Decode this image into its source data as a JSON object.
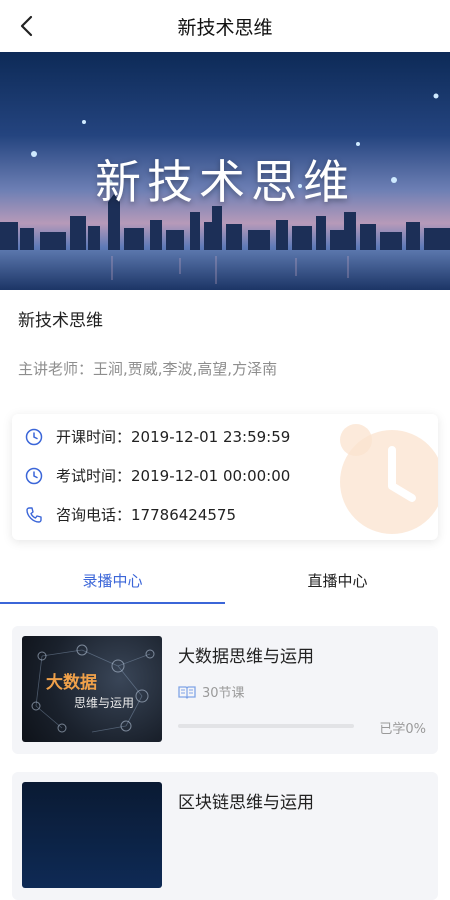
{
  "header": {
    "title": "新技术思维",
    "back_icon": "chevron-left-icon"
  },
  "banner": {
    "title": "新技术思维"
  },
  "course": {
    "name": "新技术思维",
    "teachers": "主讲老师：王涧,贾威,李波,高望,方泽南"
  },
  "info": {
    "start": {
      "label": "开课时间：",
      "value": "2019-12-01 23:59:59",
      "icon": "clock-icon"
    },
    "exam": {
      "label": "考试时间：",
      "value": "2019-12-01 00:00:00",
      "icon": "clock-icon"
    },
    "phone": {
      "label": "咨询电话：",
      "value": "17786424575",
      "icon": "phone-icon"
    }
  },
  "tabs": [
    {
      "label": "录播中心",
      "active": true
    },
    {
      "label": "直播中心",
      "active": false
    }
  ],
  "courses": [
    {
      "title": "大数据思维与运用",
      "thumb_line1": "大数据",
      "thumb_line2": "思维与运用",
      "lessons": "30节课",
      "progress_text": "已学0%",
      "progress": 0
    },
    {
      "title": "区块链思维与运用"
    }
  ],
  "colors": {
    "accent": "#3b66d8",
    "muted": "#8e8e8e",
    "deco_orange": "#fbe3cf"
  }
}
